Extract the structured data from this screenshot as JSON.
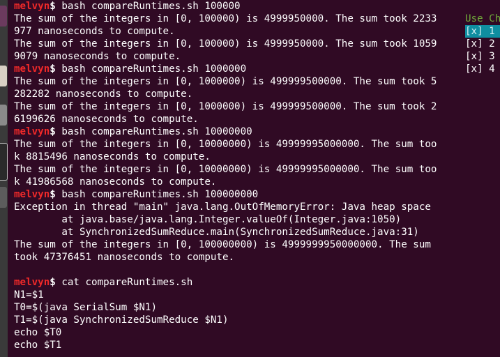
{
  "prompt": {
    "user": "melvyn",
    "sign": "$"
  },
  "terminal_lines": [
    {
      "type": "prompt",
      "cmd": " bash compareRuntimes.sh 100000"
    },
    {
      "type": "out",
      "text": "The sum of the integers in [0, 100000) is 4999950000. The sum took 2233"
    },
    {
      "type": "out",
      "text": "977 nanoseconds to compute."
    },
    {
      "type": "out",
      "text": "The sum of the integers in [0, 100000) is 4999950000. The sum took 1059"
    },
    {
      "type": "out",
      "text": "9079 nanoseconds to compute."
    },
    {
      "type": "prompt",
      "cmd": " bash compareRuntimes.sh 1000000"
    },
    {
      "type": "out",
      "text": "The sum of the integers in [0, 1000000) is 499999500000. The sum took 5"
    },
    {
      "type": "out",
      "text": "282282 nanoseconds to compute."
    },
    {
      "type": "out",
      "text": "The sum of the integers in [0, 1000000) is 499999500000. The sum took 2"
    },
    {
      "type": "out",
      "text": "6199626 nanoseconds to compute."
    },
    {
      "type": "prompt",
      "cmd": " bash compareRuntimes.sh 10000000"
    },
    {
      "type": "out",
      "text": "The sum of the integers in [0, 10000000) is 49999995000000. The sum too"
    },
    {
      "type": "out",
      "text": "k 8815496 nanoseconds to compute."
    },
    {
      "type": "out",
      "text": "The sum of the integers in [0, 10000000) is 49999995000000. The sum too"
    },
    {
      "type": "out",
      "text": "k 41986568 nanoseconds to compute."
    },
    {
      "type": "prompt",
      "cmd": " bash compareRuntimes.sh 100000000"
    },
    {
      "type": "out",
      "text": "Exception in thread \"main\" java.lang.OutOfMemoryError: Java heap space"
    },
    {
      "type": "out",
      "text": "        at java.base/java.lang.Integer.valueOf(Integer.java:1050)"
    },
    {
      "type": "out",
      "text": "        at SynchronizedSumReduce.main(SynchronizedSumReduce.java:31)"
    },
    {
      "type": "out",
      "text": "The sum of the integers in [0, 100000000) is 4999999950000000. The sum"
    },
    {
      "type": "out",
      "text": "took 47376451 nanoseconds to compute."
    },
    {
      "type": "out",
      "text": ""
    },
    {
      "type": "prompt",
      "cmd": " cat compareRuntimes.sh"
    },
    {
      "type": "out",
      "text": "N1=$1"
    },
    {
      "type": "out",
      "text": "T0=$(java SerialSum $N1)"
    },
    {
      "type": "out",
      "text": "T1=$(java SynchronizedSumReduce $N1)"
    },
    {
      "type": "out",
      "text": "echo $T0"
    },
    {
      "type": "out",
      "text": "echo $T1"
    }
  ],
  "side_panel": {
    "header": "Use Ch",
    "items": [
      {
        "box": "[x]",
        "label": " 1",
        "selected": true
      },
      {
        "box": "[x]",
        "label": " 2",
        "selected": false
      },
      {
        "box": "[x]",
        "label": " 3",
        "selected": false
      },
      {
        "box": "[x]",
        "label": " 4",
        "selected": false
      }
    ]
  },
  "colors": {
    "background": "#300a24",
    "prompt_user": "#ef2929",
    "panel_header": "#6fa83a",
    "panel_selected": "#0f8ea0"
  }
}
